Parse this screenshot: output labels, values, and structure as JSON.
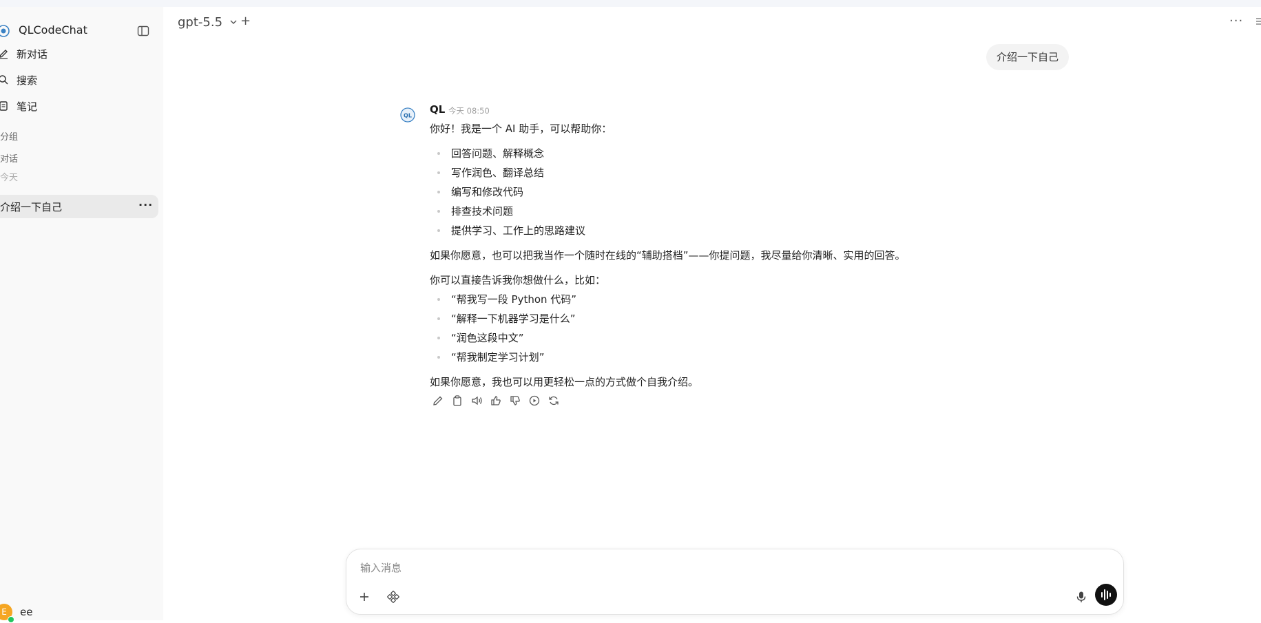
{
  "app": {
    "title": "QLCodeChat"
  },
  "sidebar": {
    "nav": [
      {
        "label": "新对话",
        "icon": "edit-icon"
      },
      {
        "label": "搜索",
        "icon": "search-icon"
      },
      {
        "label": "笔记",
        "icon": "notes-icon"
      }
    ],
    "section_groups": "分组",
    "section_chats": "对话",
    "section_today": "今天",
    "chat_items": [
      {
        "label": "介绍一下自己",
        "more": "···"
      }
    ],
    "user": {
      "avatar_letter": "E",
      "name": "ee"
    }
  },
  "header": {
    "model": "gpt-5.5",
    "new_label": "+",
    "more_label": "···"
  },
  "conversation": {
    "user_message": "介绍一下自己",
    "bot": {
      "name": "QL",
      "time": "今天 08:50",
      "intro": "你好！我是一个 AI 助手，可以帮助你：",
      "capabilities": [
        "回答问题、解释概念",
        "写作润色、翻译总结",
        "编写和修改代码",
        "排查技术问题",
        "提供学习、工作上的思路建议"
      ],
      "paragraph1": "如果你愿意，也可以把我当作一个随时在线的“辅助搭档”——你提问题，我尽量给你清晰、实用的回答。",
      "paragraph2": "你可以直接告诉我你想做什么，比如：",
      "examples": [
        "“帮我写一段 Python 代码”",
        "“解释一下机器学习是什么”",
        "“润色这段中文”",
        "“帮我制定学习计划”"
      ],
      "closing": "如果你愿意，我也可以用更轻松一点的方式做个自我介绍。"
    },
    "actions": [
      "edit-icon",
      "copy-icon",
      "speaker-icon",
      "thumbs-up-icon",
      "thumbs-down-icon",
      "play-icon",
      "regenerate-icon"
    ]
  },
  "composer": {
    "placeholder": "输入消息"
  }
}
